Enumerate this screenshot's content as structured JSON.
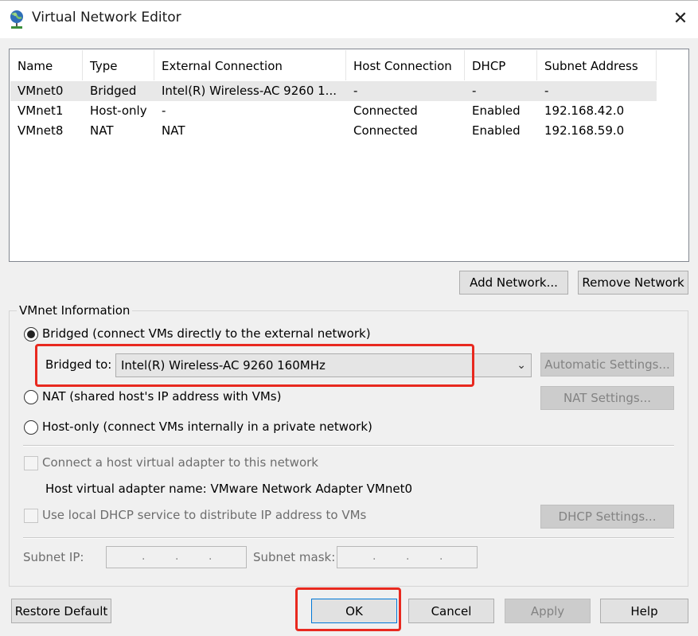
{
  "window": {
    "title": "Virtual Network Editor",
    "close_symbol": "✕"
  },
  "list": {
    "columns": [
      "Name",
      "Type",
      "External Connection",
      "Host Connection",
      "DHCP",
      "Subnet Address"
    ],
    "rows": [
      [
        "VMnet0",
        "Bridged",
        "Intel(R) Wireless-AC 9260 1...",
        "-",
        "-",
        "-"
      ],
      [
        "VMnet1",
        "Host-only",
        "-",
        "Connected",
        "Enabled",
        "192.168.42.0"
      ],
      [
        "VMnet8",
        "NAT",
        "NAT",
        "Connected",
        "Enabled",
        "192.168.59.0"
      ]
    ]
  },
  "actions": {
    "add_network": "Add Network...",
    "remove_network": "Remove Network"
  },
  "vmnet_info": {
    "label": "VMnet Information",
    "bridged_radio": "Bridged (connect VMs directly to the external network)",
    "bridged_to_label": "Bridged to:",
    "bridged_to_value": "Intel(R) Wireless-AC 9260 160MHz",
    "automatic_settings": "Automatic Settings...",
    "nat_radio": "NAT (shared host's IP address with VMs)",
    "nat_settings": "NAT Settings...",
    "hostonly_radio": "Host-only (connect VMs internally in a private network)",
    "connect_adapter": "Connect a host virtual adapter to this network",
    "adapter_name": "Host virtual adapter name: VMware Network Adapter VMnet0",
    "use_dhcp": "Use local DHCP service to distribute IP address to VMs",
    "dhcp_settings": "DHCP Settings...",
    "subnet_ip_label": "Subnet IP:",
    "subnet_mask_label": "Subnet mask:",
    "selected_mode": "bridged"
  },
  "footer": {
    "restore_default": "Restore Default",
    "ok": "OK",
    "cancel": "Cancel",
    "apply": "Apply",
    "help": "Help"
  },
  "colors": {
    "highlight_box": "#e8291f",
    "selected_row": "#e8e8e8"
  },
  "icons": {
    "app": "network-globe-icon",
    "combo": "chevron-down-icon"
  }
}
